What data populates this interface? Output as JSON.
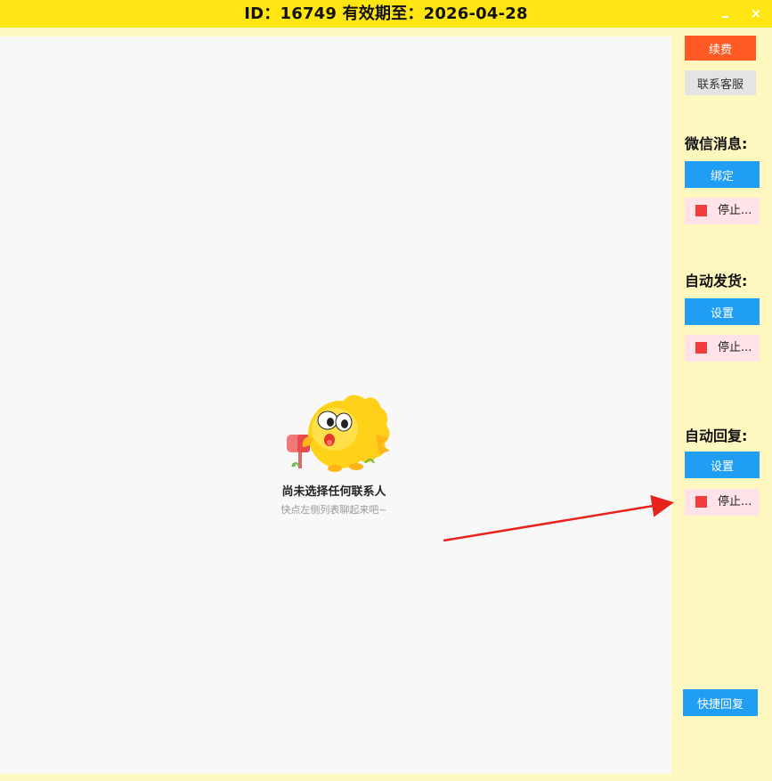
{
  "title": {
    "text": "ID：16749   有效期至：2026-04-28"
  },
  "window": {
    "minimize": "–",
    "close": "×"
  },
  "chat": {
    "empty_title": "尚未选择任何联系人",
    "empty_subtitle": "快点左侧列表聊起来吧~"
  },
  "sidebar": {
    "renew_label": "续费",
    "support_label": "联系客服",
    "wechat": {
      "title": "微信消息:",
      "bind_label": "绑定",
      "stop_label": "停止..."
    },
    "auto_ship": {
      "title": "自动发货:",
      "set_label": "设置",
      "stop_label": "停止..."
    },
    "auto_reply": {
      "title": "自动回复:",
      "set_label": "设置",
      "stop_label": "停止..."
    },
    "quick_reply_label": "快捷回复"
  },
  "colors": {
    "titlebar": "#ffe512",
    "sidebar_bg": "#fff7c0",
    "accent_blue": "#1f9ef3",
    "renew_orange": "#ff5a26",
    "stop_red": "#f23b3b",
    "arrow_red": "#e8231e"
  }
}
